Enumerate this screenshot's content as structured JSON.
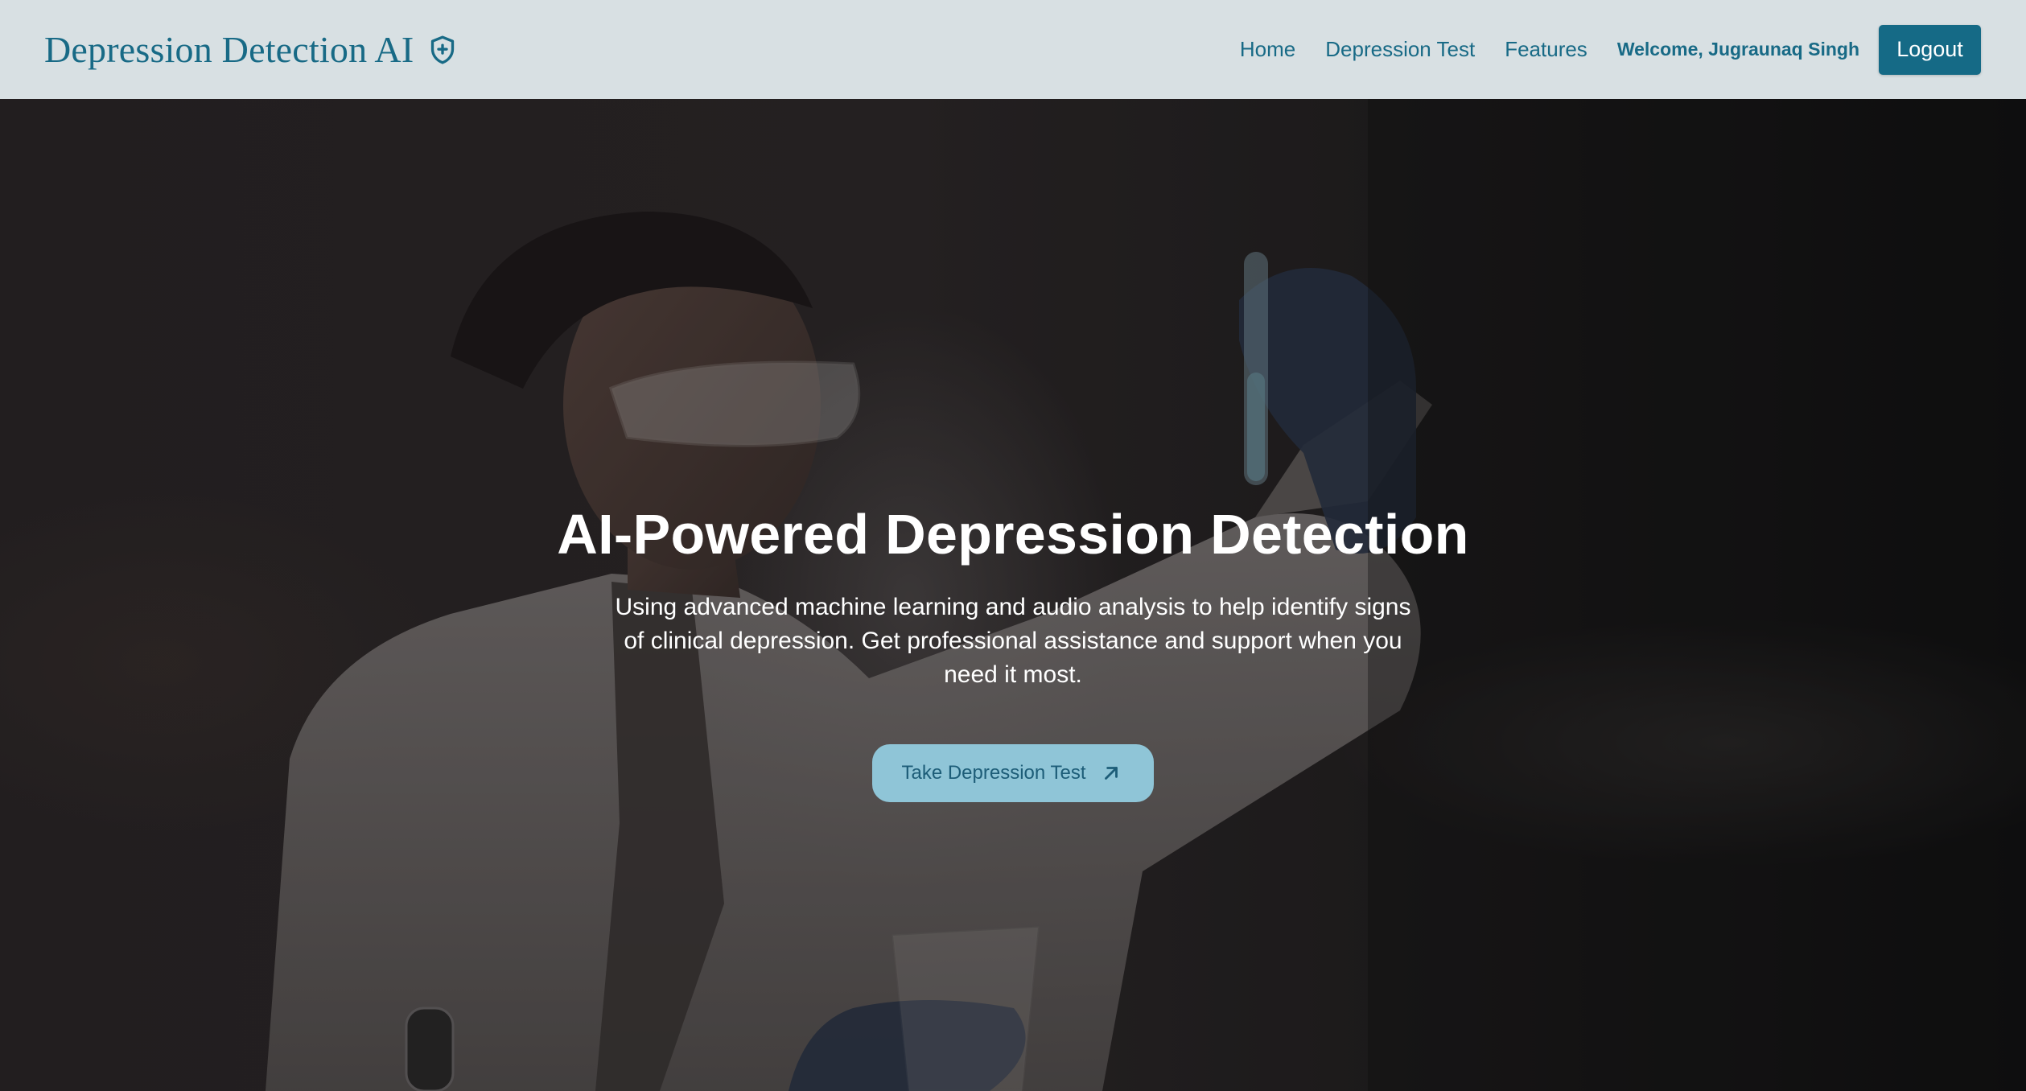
{
  "header": {
    "brand": "Depression Detection AI",
    "brand_icon": "shield-plus-icon",
    "nav": {
      "home": "Home",
      "test": "Depression Test",
      "features": "Features"
    },
    "welcome": "Welcome, Jugraunaq Singh",
    "logout": "Logout"
  },
  "hero": {
    "title": "AI-Powered Depression Detection",
    "subtitle": "Using advanced machine learning and audio analysis to help identify signs of clinical depression. Get professional assistance and support when you need it most.",
    "cta_label": "Take Depression Test",
    "cta_icon": "arrow-up-right-icon",
    "background_image": "scientist-in-lab-coat-holding-test-tube"
  },
  "colors": {
    "navbar_bg": "#d8e0e3",
    "brand_teal": "#186a86",
    "logout_bg": "#156a86",
    "cta_bg": "#8fc5d7",
    "cta_text": "#1d5d78",
    "hero_text": "#ffffff"
  }
}
